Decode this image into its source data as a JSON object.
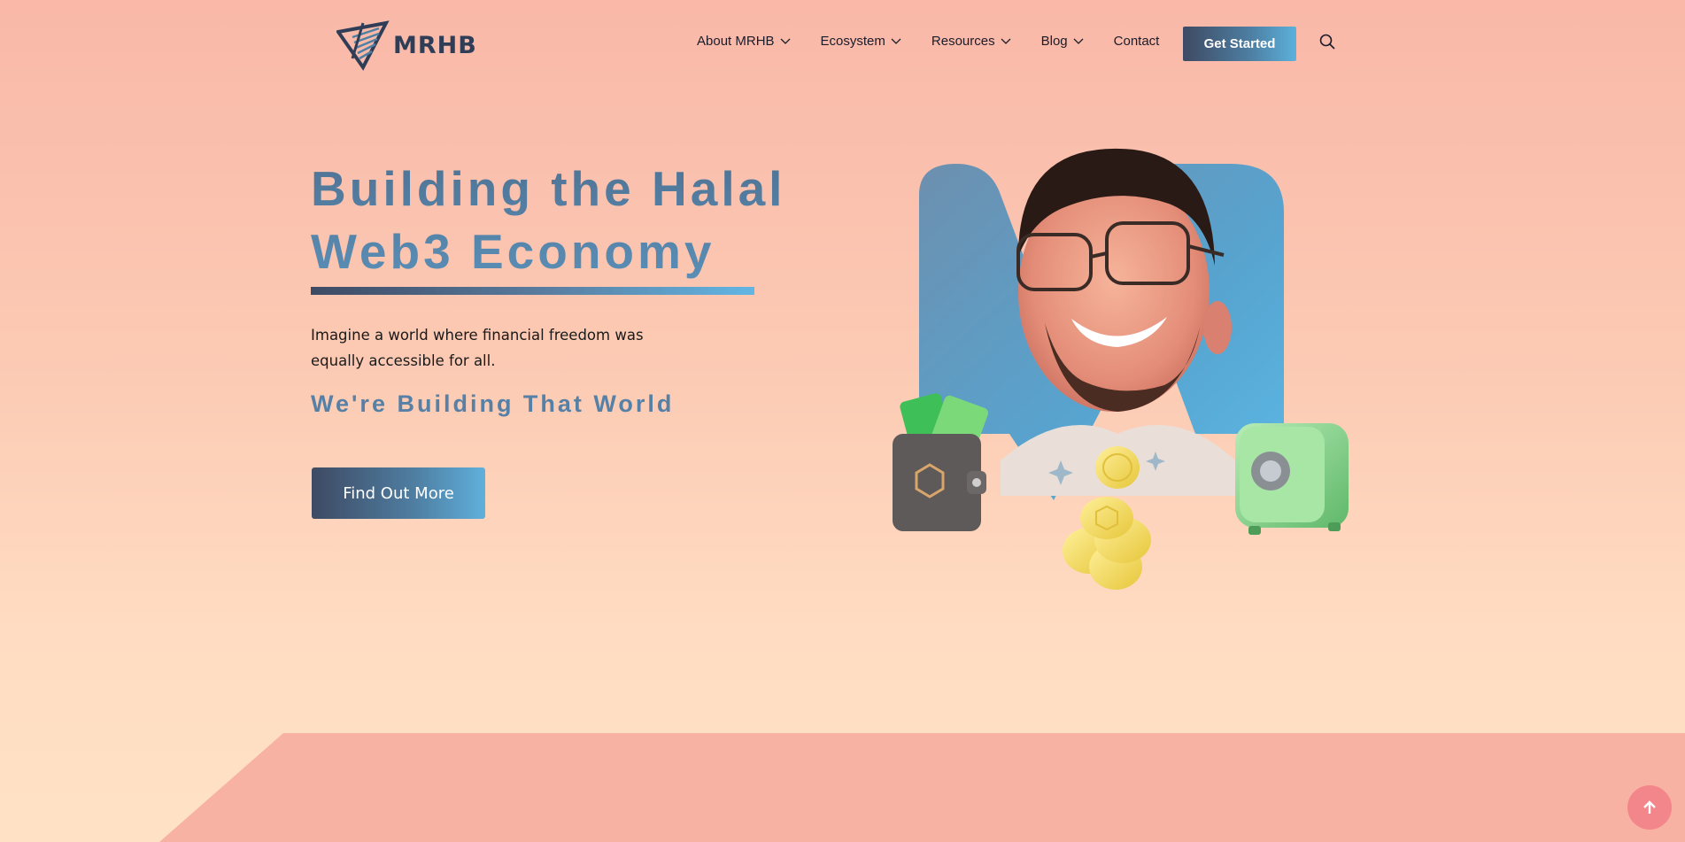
{
  "brand": {
    "name": "MRHB",
    "logo_icon": "mrhb-triangle-logo"
  },
  "nav": {
    "items": [
      {
        "label": "About MRHB",
        "has_dropdown": true
      },
      {
        "label": "Ecosystem",
        "has_dropdown": true
      },
      {
        "label": "Resources",
        "has_dropdown": true
      },
      {
        "label": "Blog",
        "has_dropdown": true
      },
      {
        "label": "Contact",
        "has_dropdown": false
      }
    ],
    "cta_label": "Get Started",
    "search_icon": "search-icon"
  },
  "hero": {
    "title_line1": "Building the Halal",
    "title_line2": "Web3 Economy",
    "intro_line1": "Imagine a world where financial freedom was",
    "intro_line2": "equally accessible for all.",
    "tagline": "We're Building That World",
    "button_label": "Find Out More",
    "illustration": "smiling-man-with-wallet-coins-safe-illustration"
  },
  "colors": {
    "accent_dark": "#3e4a63",
    "accent_light": "#5fb0dc",
    "background_top": "#f9b8a8",
    "background_bottom": "#ffe2c6",
    "back_to_top": "#f3868a"
  },
  "back_to_top": {
    "icon": "arrow-up-icon"
  }
}
